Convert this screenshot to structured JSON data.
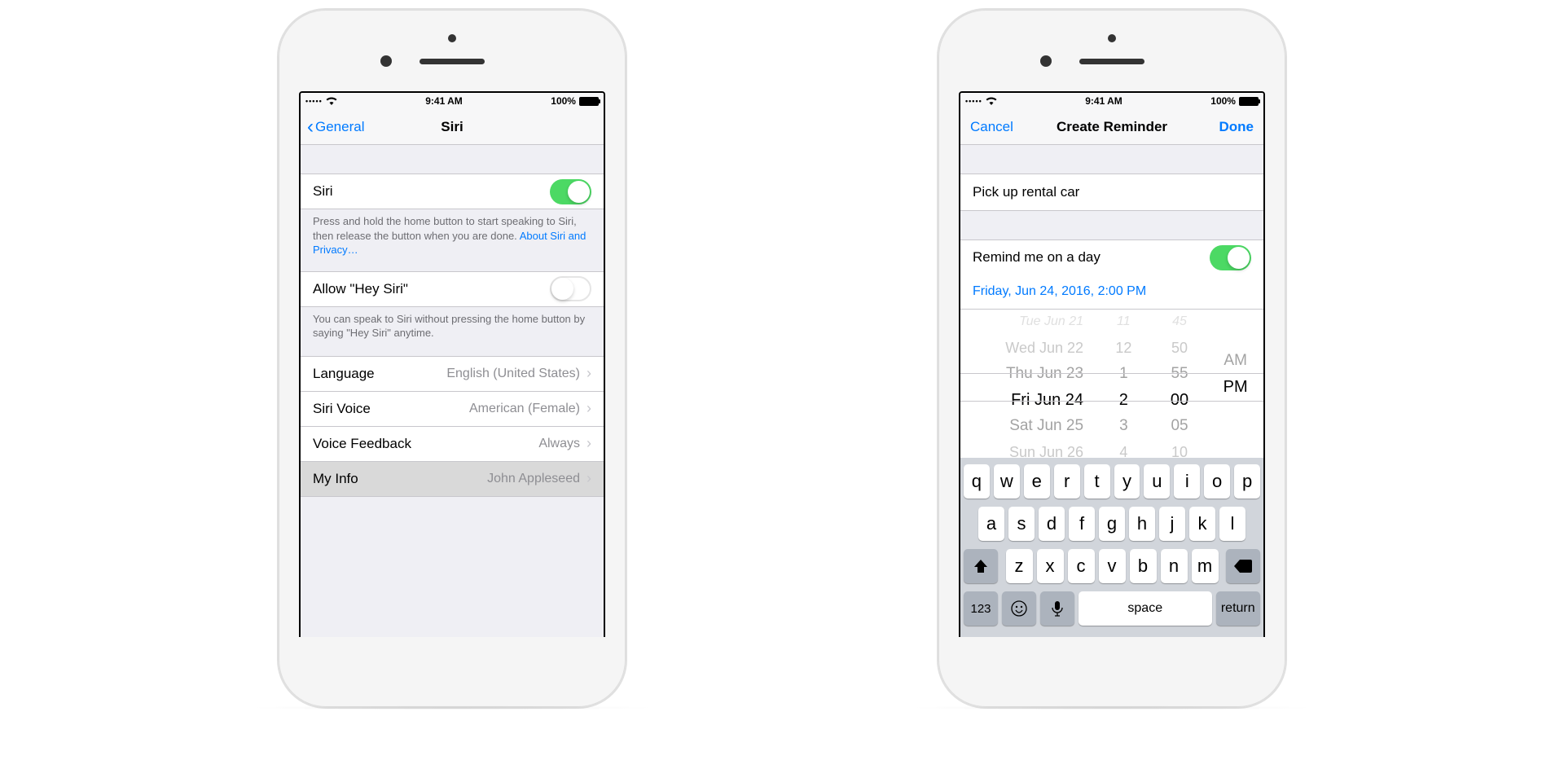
{
  "status_bar": {
    "time": "9:41 AM",
    "battery": "100%",
    "signal_dots": "•••••"
  },
  "phone1": {
    "nav_back": "General",
    "nav_title": "Siri",
    "siri_label": "Siri",
    "siri_footer_text": "Press and hold the home button to start speaking to Siri, then release the button when you are done. ",
    "siri_footer_link": "About Siri and Privacy…",
    "hey_siri_label": "Allow \"Hey Siri\"",
    "hey_siri_footer": "You can speak to Siri without pressing the home button by saying \"Hey Siri\" anytime.",
    "language_label": "Language",
    "language_value": "English (United States)",
    "voice_label": "Siri Voice",
    "voice_value": "American (Female)",
    "feedback_label": "Voice Feedback",
    "feedback_value": "Always",
    "myinfo_label": "My Info",
    "myinfo_value": "John Appleseed"
  },
  "phone2": {
    "nav_cancel": "Cancel",
    "nav_title": "Create Reminder",
    "nav_done": "Done",
    "reminder_text": "Pick up rental car",
    "remind_day_label": "Remind me on a day",
    "date_display": "Friday, Jun 24, 2016, 2:00 PM",
    "picker": {
      "dates": [
        "Tue Jun 21",
        "Wed Jun 22",
        "Thu Jun 23",
        "Fri Jun 24",
        "Sat Jun 25",
        "Sun Jun 26"
      ],
      "hours": [
        "11",
        "12",
        "1",
        "2",
        "3",
        "4"
      ],
      "minutes": [
        "45",
        "50",
        "55",
        "00",
        "05",
        "10"
      ],
      "ampm": [
        "AM",
        "PM"
      ]
    },
    "keyboard": {
      "row1": [
        "q",
        "w",
        "e",
        "r",
        "t",
        "y",
        "u",
        "i",
        "o",
        "p"
      ],
      "row2": [
        "a",
        "s",
        "d",
        "f",
        "g",
        "h",
        "j",
        "k",
        "l"
      ],
      "row3": [
        "z",
        "x",
        "c",
        "v",
        "b",
        "n",
        "m"
      ],
      "shift": "⇧",
      "backspace": "⌫",
      "numbers": "123",
      "emoji": "☺",
      "mic": "🎤",
      "space": "space",
      "return": "return"
    }
  }
}
